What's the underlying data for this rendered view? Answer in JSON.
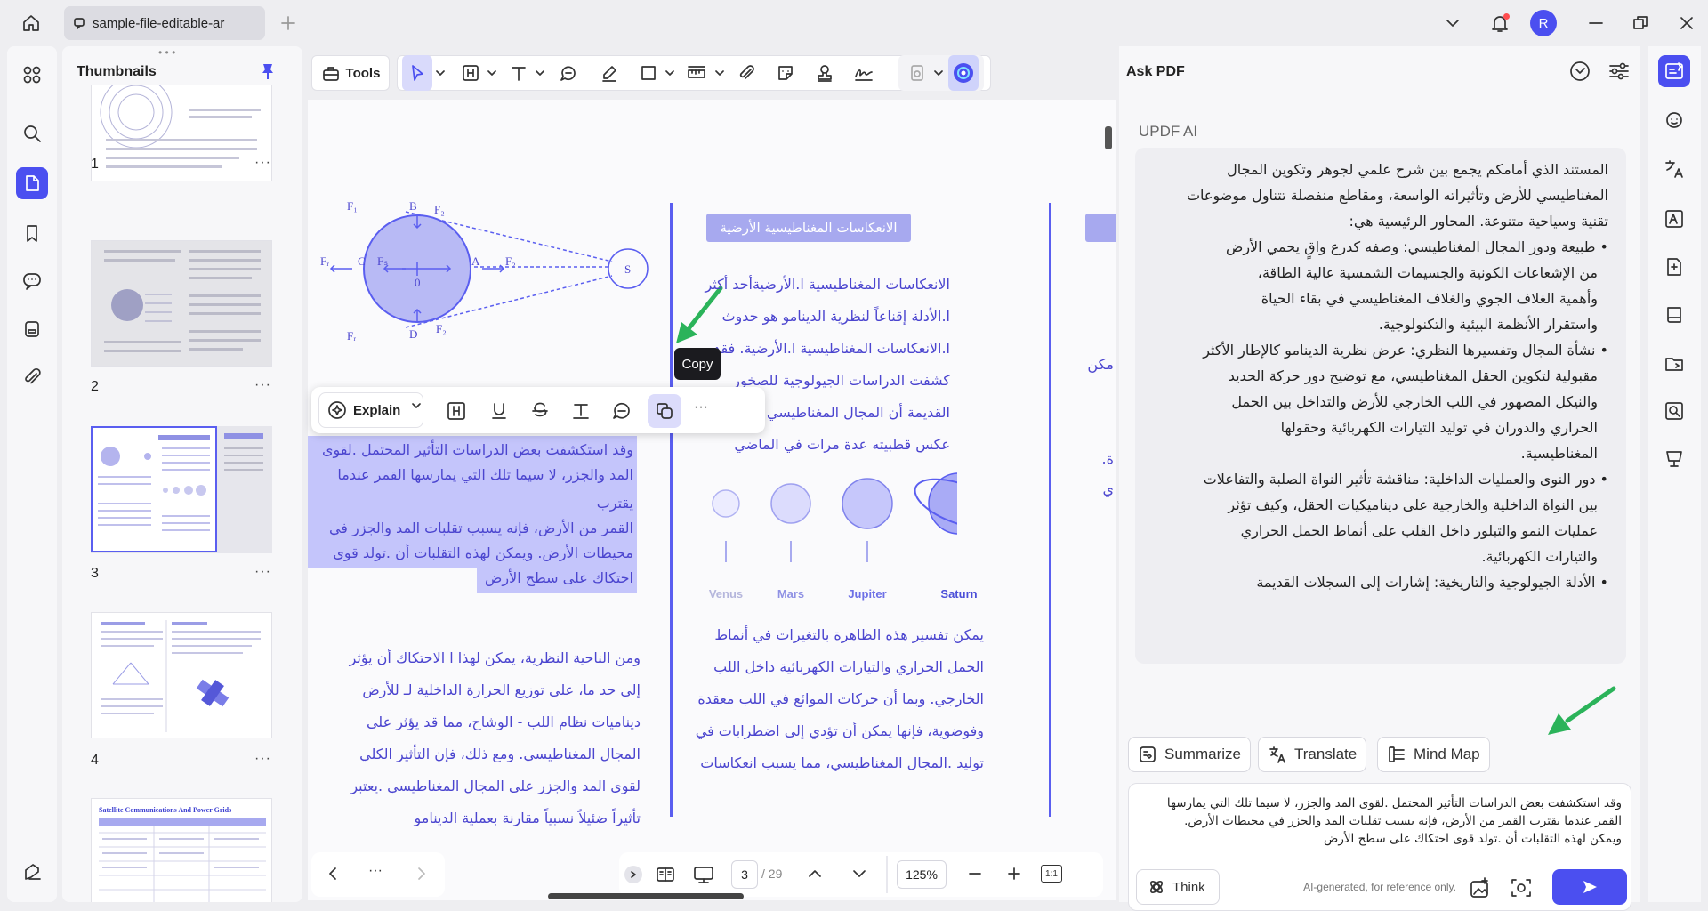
{
  "titlebar": {
    "tab_title": "sample-file-editable-ar",
    "avatar_letter": "R",
    "accent": "#4b4ff0"
  },
  "thumbnails": {
    "title": "Thumbnails",
    "pages": [
      "1",
      "2",
      "3",
      "4"
    ],
    "more": "···",
    "page5_title": "Satellite Communications And Power Grids"
  },
  "toolbar": {
    "tools_label": "Tools"
  },
  "document": {
    "section_heading": "الانعكاسات المغناطيسية الأرضية",
    "diagram_labels": {
      "f1": "F₁",
      "b": "B",
      "f2": "F₂",
      "fr": "Fᵣ",
      "c": "C",
      "fs": "Fₛ",
      "o": "0",
      "a": "A",
      "s": "S",
      "d": "D"
    },
    "highlight_paragraph": [
      "وقد استكشفت بعض الدراسات التأثير المحتمل .لقوى",
      "المد والجزر، لا سيما تلك التي يمارسها القمر عندما يقترب",
      "القمر من الأرض، فإنه يسبب تقلبات المد والجزر في",
      "محيطات الأرض. ويمكن لهذه التقلبات أن .تولد قوى",
      "احتكاك على سطح الأرض"
    ],
    "left_paragraph": [
      "ومن الناحية النظرية، يمكن لهذا ا الاحتكاك أن يؤثر",
      "إلى حد ما، على توزيع الحرارة الداخلية لـ للأرض",
      "ديناميات نظام اللب - الوشاح، مما قد يؤثر على",
      "المجال المغناطيسي. ومع ذلك، فإن التأثير الكلي",
      "لقوى المد والجزر على المجال المغناطيسي .يعتبر",
      "تأثيراً ضئيلاً نسبياً مقارنة بعملية الدينامو"
    ],
    "mid_paragraph_top": [
      "الانعكاسات المغناطيسية ا.الأرضيةأحد أكثر",
      "ا.الأدلة إقناعاً لنظرية الدينامو هو حدوث",
      "ا.الانعكاسات المغناطيسية ا.الأرضية. فقد",
      "كشفت الدراسات الجيولوجية للصخور",
      "القديمة أن المجال المغناطيسي .للأرض",
      "عكس قطبيته عدة مرات في الماضي"
    ],
    "planets": [
      "Venus",
      "Mars",
      "Jupiter",
      "Saturn"
    ],
    "mid_paragraph_bottom": [
      "يمكن تفسير هذه الظاهرة بالتغيرات في أنماط",
      "الحمل الحراري والتيارات الكهربائية داخل اللب",
      "الخارجي. وبما أن حركات الموائع في اللب معقدة",
      "وفوضوية، فإنها يمكن أن تؤدي إلى اضطرابات في",
      "توليد .المجال المغناطيسي، مما يسبب انعكاسات"
    ],
    "right_edge_fragments": [
      "مكن",
      "ة.",
      "ي"
    ]
  },
  "floatbar": {
    "explain_label": "Explain",
    "copy_tooltip": "Copy",
    "more": "···"
  },
  "navigation": {
    "current_page": "3",
    "total_pages": "/ 29",
    "zoom": "125%",
    "more": "···",
    "fit_label": "1:1"
  },
  "ask_pdf": {
    "title": "Ask PDF",
    "ai_name": "UPDF AI",
    "response_intro": [
      "المستند الذي أمامكم يجمع بين شرح علمي لجوهر وتكوين المجال",
      "المغناطيسي للأرض وتأثيراته الواسعة، ومقاطع منفصلة تتناول موضوعات",
      "تقنية وسياحية متنوعة. المحاور الرئيسية هي:"
    ],
    "bullets": [
      [
        "طبيعة ودور المجال المغناطيسي: وصفه كدرع واقٍ يحمي الأرض",
        "من الإشعاعات الكونية والجسيمات الشمسية عالية الطاقة،",
        "وأهمية الغلاف الجوي والغلاف المغناطيسي في بقاء الحياة",
        "واستقرار الأنظمة البيئية والتكنولوجية."
      ],
      [
        "نشأة المجال وتفسيرها النظري: عرض نظرية الدينامو كالإطار الأكثر",
        "مقبولية لتكوين الحقل المغناطيسي، مع توضيح دور حركة الحديد",
        "والنيكل المصهور في اللب الخارجي للأرض والتداخل بين الحمل",
        "الحراري والدوران في توليد التيارات الكهربائية وحقولها",
        "المغناطيسية."
      ],
      [
        "دور النوى والعمليات الداخلية: مناقشة تأثير النواة الصلبة والتفاعلات",
        "بين النواة الداخلية والخارجية على ديناميكيات الحقل، وكيف تؤثر",
        "عمليات النمو والتبلور داخل القلب على أنماط الحمل الحراري",
        "والتيارات الكهربائية."
      ],
      [
        "الأدلة الجيولوجية والتاريخية: إشارات إلى السجلات القديمة"
      ]
    ],
    "actions": [
      "Summarize",
      "Translate",
      "Mind Map"
    ],
    "input_text": [
      "وقد استكشفت بعض الدراسات التأثير المحتمل .لقوى المد والجزر، لا سيما تلك التي يمارسها",
      "القمر عندما يقترب القمر من الأرض، فإنه يسبب تقلبات المد والجزر في محيطات الأرض.",
      "ويمكن لهذه التقلبات أن .تولد قوى احتكاك على سطح الأرض"
    ],
    "think_label": "Think",
    "disclaimer": "AI-generated, for reference only."
  }
}
